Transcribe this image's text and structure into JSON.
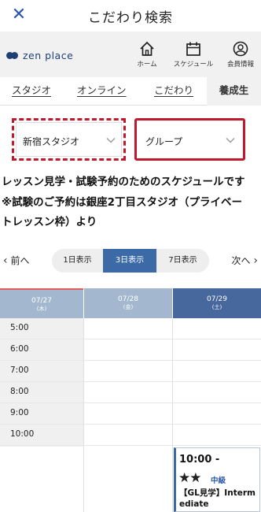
{
  "header": {
    "close_icon": "close-icon",
    "title": "こだわり検索"
  },
  "brand": {
    "name": "zen place",
    "color": "#1e3f76"
  },
  "nav": [
    {
      "icon": "home-icon",
      "label": "ホーム"
    },
    {
      "icon": "calendar-icon",
      "label": "スケジュール"
    },
    {
      "icon": "user-icon",
      "label": "会員情報"
    }
  ],
  "tabs": [
    {
      "label": "スタジオ",
      "active": false
    },
    {
      "label": "オンライン",
      "active": false
    },
    {
      "label": "こだわり",
      "active": false
    },
    {
      "label": "養成生",
      "active": true
    }
  ],
  "filters": {
    "studio": {
      "value": "新宿スタジオ"
    },
    "group": {
      "value": "グループ"
    }
  },
  "notice": [
    "レッスン見学・試験予約のためのスケジュールです",
    "※試験のご予約は銀座2丁目スタジオ（プライベー",
    "トレッスン枠）より"
  ],
  "pager": {
    "prev": "前へ",
    "next": "次へ",
    "views": [
      {
        "label": "1日表示",
        "active": false
      },
      {
        "label": "3日表示",
        "active": true
      },
      {
        "label": "7日表示",
        "active": false
      }
    ]
  },
  "calendar": {
    "days": [
      {
        "date": "07/27",
        "weekday": "(木)"
      },
      {
        "date": "07/28",
        "weekday": "(金)"
      },
      {
        "date": "07/29",
        "weekday": "(土)"
      }
    ],
    "times": [
      "5:00",
      "6:00",
      "7:00",
      "8:00",
      "9:00",
      "10:00"
    ],
    "event": {
      "time": "10:00 -",
      "stars": "★★",
      "level": "中級",
      "name": "【GL見学】Intermediate"
    }
  },
  "colors": {
    "accent": "#3b6aa6",
    "highlight_red": "#c0182c"
  }
}
